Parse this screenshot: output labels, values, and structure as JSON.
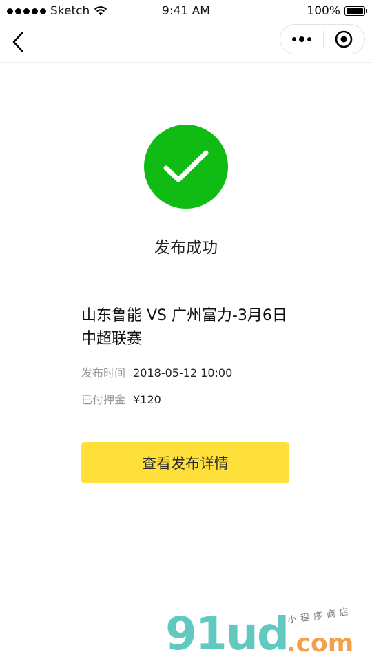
{
  "status_bar": {
    "carrier": "Sketch",
    "time": "9:41 AM",
    "battery": "100%"
  },
  "nav": {
    "back_icon": "chevron-left-icon",
    "more_icon": "more-dots-icon",
    "close_icon": "target-circle-icon"
  },
  "success": {
    "icon": "checkmark-icon",
    "color": "#10bc14",
    "title": "发布成功"
  },
  "event": {
    "title": "山东鲁能 VS 广州富力-3月6日中超联赛",
    "publish_time_label": "发布时间",
    "publish_time_value": "2018-05-12 10:00",
    "deposit_label": "已付押金",
    "deposit_value": "¥120"
  },
  "actions": {
    "view_details_label": "查看发布详情",
    "button_color": "#ffe03a"
  },
  "watermark": {
    "brand": "91ud",
    "domain": ".com",
    "tagline": "小程序商店"
  }
}
